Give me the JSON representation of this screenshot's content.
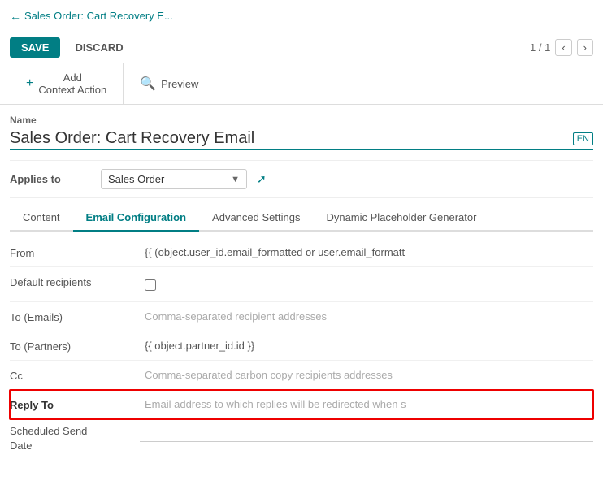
{
  "breadcrumb": {
    "back_label": "Sales Order: Cart Recovery E..."
  },
  "action_bar": {
    "save_label": "SAVE",
    "discard_label": "DISCARD",
    "pagination": "1 / 1"
  },
  "toolbar": {
    "add_context_action_label": "Add\nContext Action",
    "preview_label": "Preview"
  },
  "form": {
    "name_label": "Name",
    "name_value": "Sales Order: Cart Recovery Email",
    "lang_badge": "EN",
    "applies_to_label": "Applies to",
    "applies_to_value": "Sales Order"
  },
  "tabs": [
    {
      "id": "content",
      "label": "Content"
    },
    {
      "id": "email-configuration",
      "label": "Email Configuration"
    },
    {
      "id": "advanced-settings",
      "label": "Advanced Settings"
    },
    {
      "id": "dynamic-placeholder",
      "label": "Dynamic Placeholder Generator"
    }
  ],
  "active_tab": "email-configuration",
  "email_config": {
    "fields": [
      {
        "id": "from",
        "label": "From",
        "value": "{{ (object.user_id.email_formatted or user.email_formatt",
        "type": "text",
        "highlighted": false
      },
      {
        "id": "default-recipients",
        "label": "Default recipients",
        "value": "",
        "type": "checkbox",
        "highlighted": false
      },
      {
        "id": "to-emails",
        "label": "To (Emails)",
        "value": "",
        "placeholder": "Comma-separated recipient addresses",
        "type": "placeholder",
        "highlighted": false
      },
      {
        "id": "to-partners",
        "label": "To (Partners)",
        "value": "{{ object.partner_id.id }}",
        "type": "text",
        "highlighted": false
      },
      {
        "id": "cc",
        "label": "Cc",
        "value": "",
        "placeholder": "Comma-separated carbon copy recipients addresses",
        "type": "placeholder",
        "highlighted": false
      },
      {
        "id": "reply-to",
        "label": "Reply To",
        "value": "",
        "placeholder": "Email address to which replies will be redirected when s",
        "type": "reply-to",
        "highlighted": true
      }
    ],
    "scheduled_send_date_label": "Scheduled Send\nDate"
  }
}
